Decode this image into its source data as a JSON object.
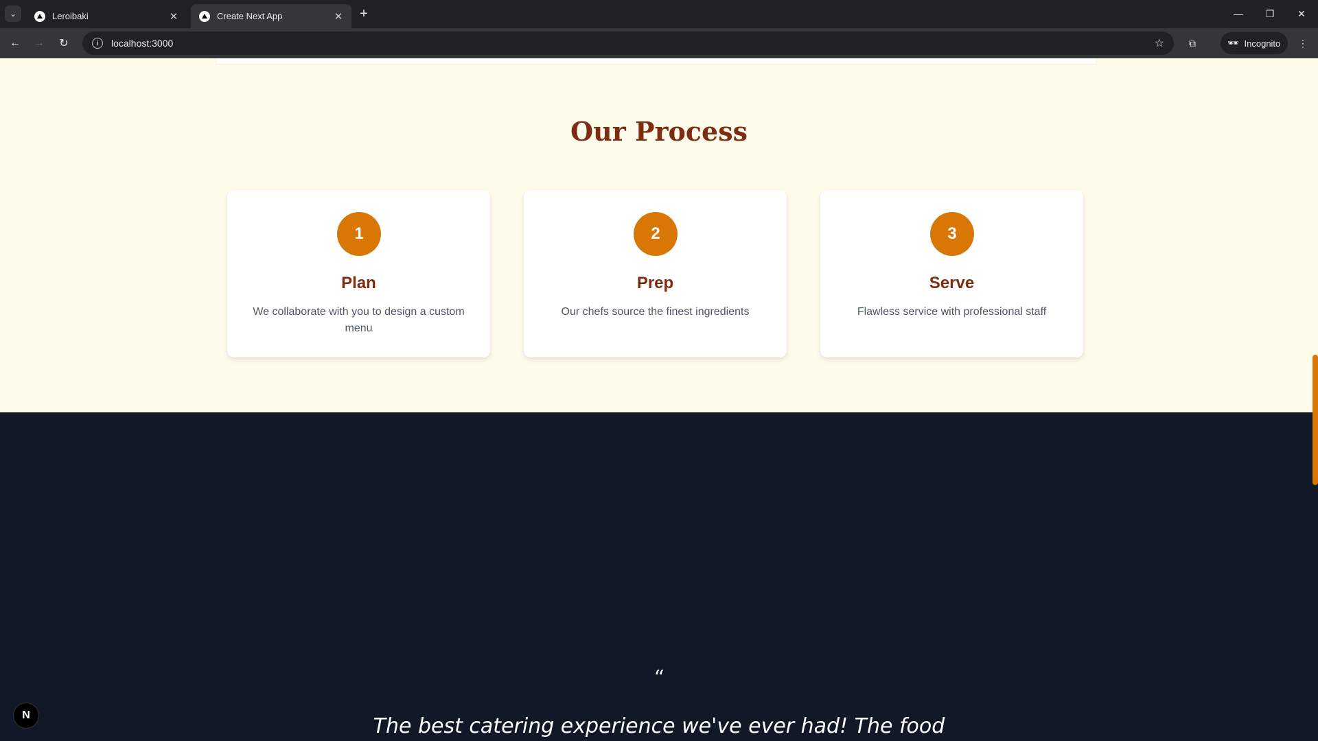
{
  "browser": {
    "tabs": [
      {
        "title": "Leroibaki",
        "active": false
      },
      {
        "title": "Create Next App",
        "active": true
      }
    ],
    "url": "localhost:3000",
    "incognito_label": "Incognito"
  },
  "process": {
    "title": "Our Process",
    "steps": [
      {
        "number": "1",
        "name": "Plan",
        "description": "We collaborate with you to design a custom menu"
      },
      {
        "number": "2",
        "name": "Prep",
        "description": "Our chefs source the finest ingredients"
      },
      {
        "number": "3",
        "name": "Serve",
        "description": "Flawless service with professional staff"
      }
    ]
  },
  "testimonial": {
    "quote_mark": "“",
    "text": "The best catering experience we've ever had! The food"
  },
  "dev_badge": "N",
  "colors": {
    "accent": "#d97706",
    "heading": "#7c2d12",
    "cream_bg": "#fffbeb",
    "dark_bg": "#111827"
  }
}
